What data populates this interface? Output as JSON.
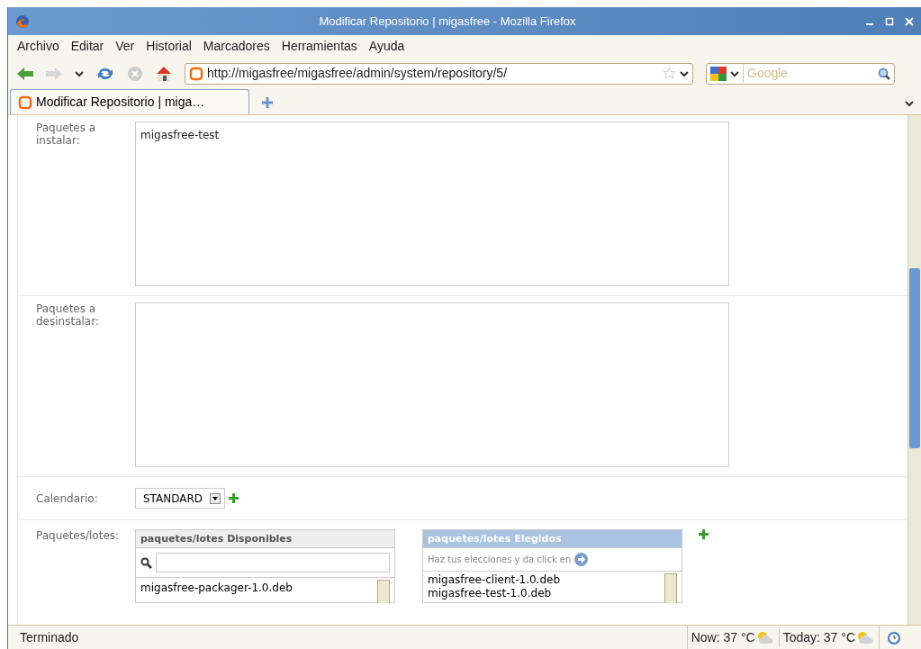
{
  "window": {
    "title": "Modificar Repositorio | migasfree - Mozilla Firefox"
  },
  "menu": [
    "Archivo",
    "Editar",
    "Ver",
    "Historial",
    "Marcadores",
    "Herramientas",
    "Ayuda"
  ],
  "address_bar": {
    "value": "http://migasfree/migasfree/admin/system/repository/5/"
  },
  "search": {
    "placeholder": "Google"
  },
  "tabs": [
    {
      "label": "Modificar Repositorio | miga…",
      "selected": true
    }
  ],
  "form": {
    "fields": [
      {
        "kind": "textarea",
        "label": "Paquetes a instalar:",
        "value": "migasfree-test"
      },
      {
        "kind": "textarea",
        "label": "Paquetes a desinstalar:"
      },
      {
        "kind": "select",
        "label": "Calendario:",
        "value": "STANDARD"
      },
      {
        "kind": "selector",
        "label": "Paquetes/lotes:",
        "available": {
          "title": "paquetes/lotes Disponibles",
          "items": [
            "migasfree-packager-1.0.deb"
          ]
        },
        "chosen": {
          "title": "paquetes/lotes Elegidos",
          "hint": "Haz tus elecciones y da click en",
          "items": [
            "migasfree-client-1.0.deb",
            "migasfree-test-1.0.deb"
          ]
        }
      }
    ]
  },
  "status_bar": {
    "text": "Terminado",
    "weather": [
      "Now: 37 °C",
      "Today: 37 °C"
    ]
  }
}
